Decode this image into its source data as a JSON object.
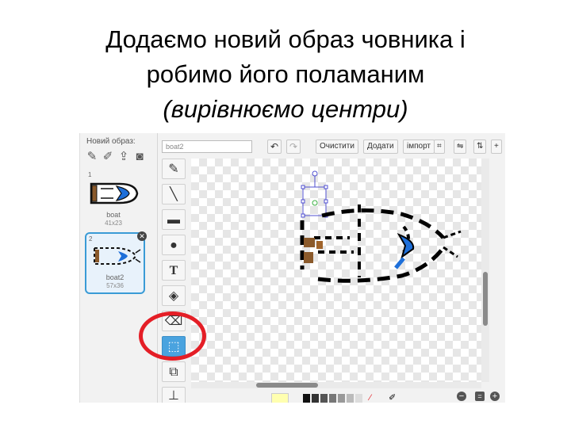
{
  "slide": {
    "title_line1": "Додаємо новий образ човника і",
    "title_line2": "робимо його поламаним",
    "title_line3": "(вирівнюємо центри)"
  },
  "costume_panel": {
    "new_costume_label": "Новий образ:",
    "icons": [
      "brush-icon",
      "pencil-icon",
      "upload-icon",
      "camera-icon"
    ],
    "costumes": [
      {
        "number": "1",
        "name": "boat",
        "size": "41x23"
      },
      {
        "number": "2",
        "name": "boat2",
        "size": "57x36"
      }
    ]
  },
  "editor": {
    "costume_name": "boat2",
    "toolbar": {
      "clear": "Очистити",
      "add": "Додати",
      "import": "імпорт"
    },
    "tools": [
      "brush-tool",
      "line-tool",
      "rectangle-tool",
      "ellipse-tool",
      "text-tool",
      "fill-tool",
      "eraser-tool",
      "select-tool",
      "duplicate-tool",
      "stamp-tool"
    ],
    "text_tool_glyph": "T",
    "selected_tool": "select-tool"
  },
  "colors": {
    "highlight_ring": "#e41e26",
    "selected_tool": "#4aa3df",
    "boat_blue": "#1e6fd9",
    "boat_brown": "#8b5a2b"
  }
}
